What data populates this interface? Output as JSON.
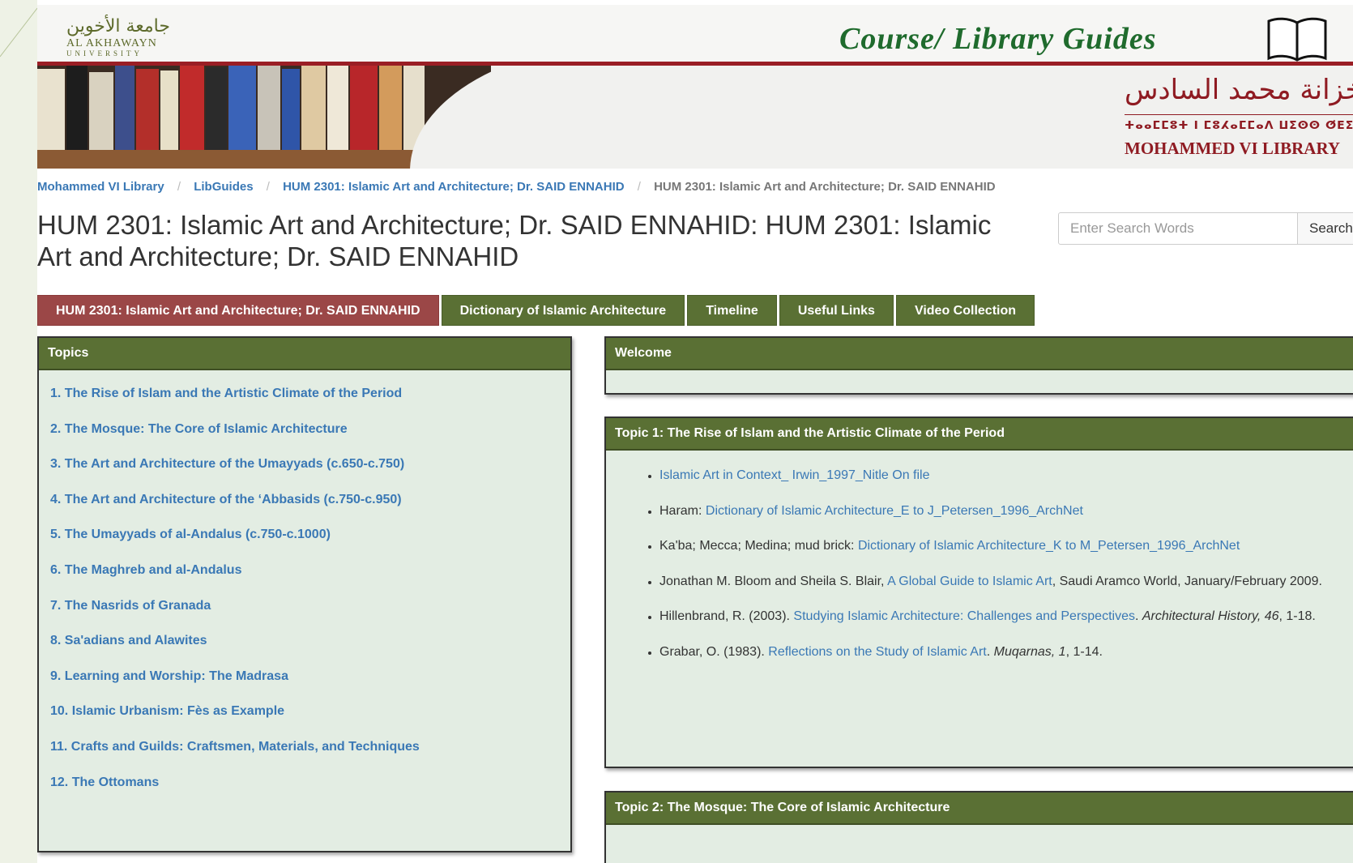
{
  "header": {
    "university_ar": "جامعة الأخوين",
    "university_en": "AL AKHAWAYN",
    "university_en_sub": "UNIVERSITY",
    "guides_title": "Course/ Library  Guides",
    "library_ar": "خزانة محمد السادس",
    "library_tifinagh": "ⵜⴰⴰⵎⵎⵓⵜ ⵏ ⵎⵓⵃⴰⵎⵎⴰⴷ ⵡⵉⵙⵙ ⵚⴹⵉⵚ",
    "library_en": "MOHAMMED VI LIBRARY",
    "book_icon": "open-book-icon",
    "colors": {
      "banner_red": "#9a1e25",
      "title_green": "#1f6b2d",
      "tab_green": "#5a7034",
      "tab_active": "#9b4747",
      "link": "#3a78b5"
    }
  },
  "breadcrumb": {
    "items": [
      "Mohammed VI Library",
      "LibGuides",
      "HUM 2301: Islamic Art and Architecture; Dr. SAID ENNAHID"
    ],
    "separator": "/",
    "current": "HUM 2301: Islamic Art and Architecture; Dr. SAID ENNAHID"
  },
  "page": {
    "title": "HUM 2301: Islamic Art and Architecture; Dr. SAID ENNAHID: HUM 2301: Islamic Art and Architecture; Dr. SAID ENNAHID"
  },
  "search": {
    "placeholder": "Enter Search Words",
    "button_label": "Search"
  },
  "tabs": [
    {
      "label": "HUM 2301: Islamic Art and Architecture; Dr. SAID ENNAHID",
      "active": true
    },
    {
      "label": "Dictionary of Islamic Architecture",
      "active": false
    },
    {
      "label": "Timeline",
      "active": false
    },
    {
      "label": "Useful Links",
      "active": false
    },
    {
      "label": "Video Collection",
      "active": false
    }
  ],
  "topics_box": {
    "title": "Topics",
    "items": [
      "1.  The Rise of Islam and the Artistic Climate of the Period",
      "2.  The Mosque: The Core of Islamic Architecture",
      "3.  The Art and Architecture of the Umayyads (c.650-c.750)",
      "4.  The Art and Architecture of the ‘Abbasids (c.750-c.950)",
      "5.  The Umayyads of al-Andalus (c.750-c.1000)",
      "6.  The Maghreb and al-Andalus",
      "7.  The Nasrids of Granada",
      "8.  Sa'adians and Alawites",
      "9.  Learning and Worship: The Madrasa",
      "10. Islamic Urbanism: Fès as Example",
      "11. Crafts and Guilds: Craftsmen, Materials, and Techniques",
      "12. The Ottomans"
    ]
  },
  "welcome_box": {
    "title": "Welcome"
  },
  "topic1_box": {
    "title": "Topic 1: The Rise of Islam and the Artistic Climate of the Period",
    "items": [
      {
        "link": "Islamic Art in Context_ Irwin_1997_Nitle On file"
      },
      {
        "prefix": "Haram: ",
        "link": "Dictionary of Islamic Architecture_E to J_Petersen_1996_ArchNet"
      },
      {
        "prefix": "Ka'ba; Mecca; Medina; mud brick:  ",
        "link": "Dictionary of Islamic Architecture_K to M_Petersen_1996_ArchNet"
      },
      {
        "prefix": "Jonathan M. Bloom and Sheila S. Blair, ",
        "link": "A Global Guide to Islamic Art",
        "suffix": ", Saudi Aramco World, January/February 2009."
      },
      {
        "prefix": "Hillenbrand, R. (2003). ",
        "link": "Studying Islamic Architecture: Challenges and Perspectives",
        "suffix": ". ",
        "italic": "Architectural History, 46",
        "suffix2": ", 1-18."
      },
      {
        "prefix": "Grabar, O. (1983). ",
        "link": "Reflections on the Study of Islamic Art",
        "suffix": ". ",
        "italic": "Muqarnas, 1",
        "suffix2": ", 1-14."
      }
    ]
  },
  "topic2_box": {
    "title": "Topic 2: The Mosque: The Core of Islamic Architecture"
  }
}
